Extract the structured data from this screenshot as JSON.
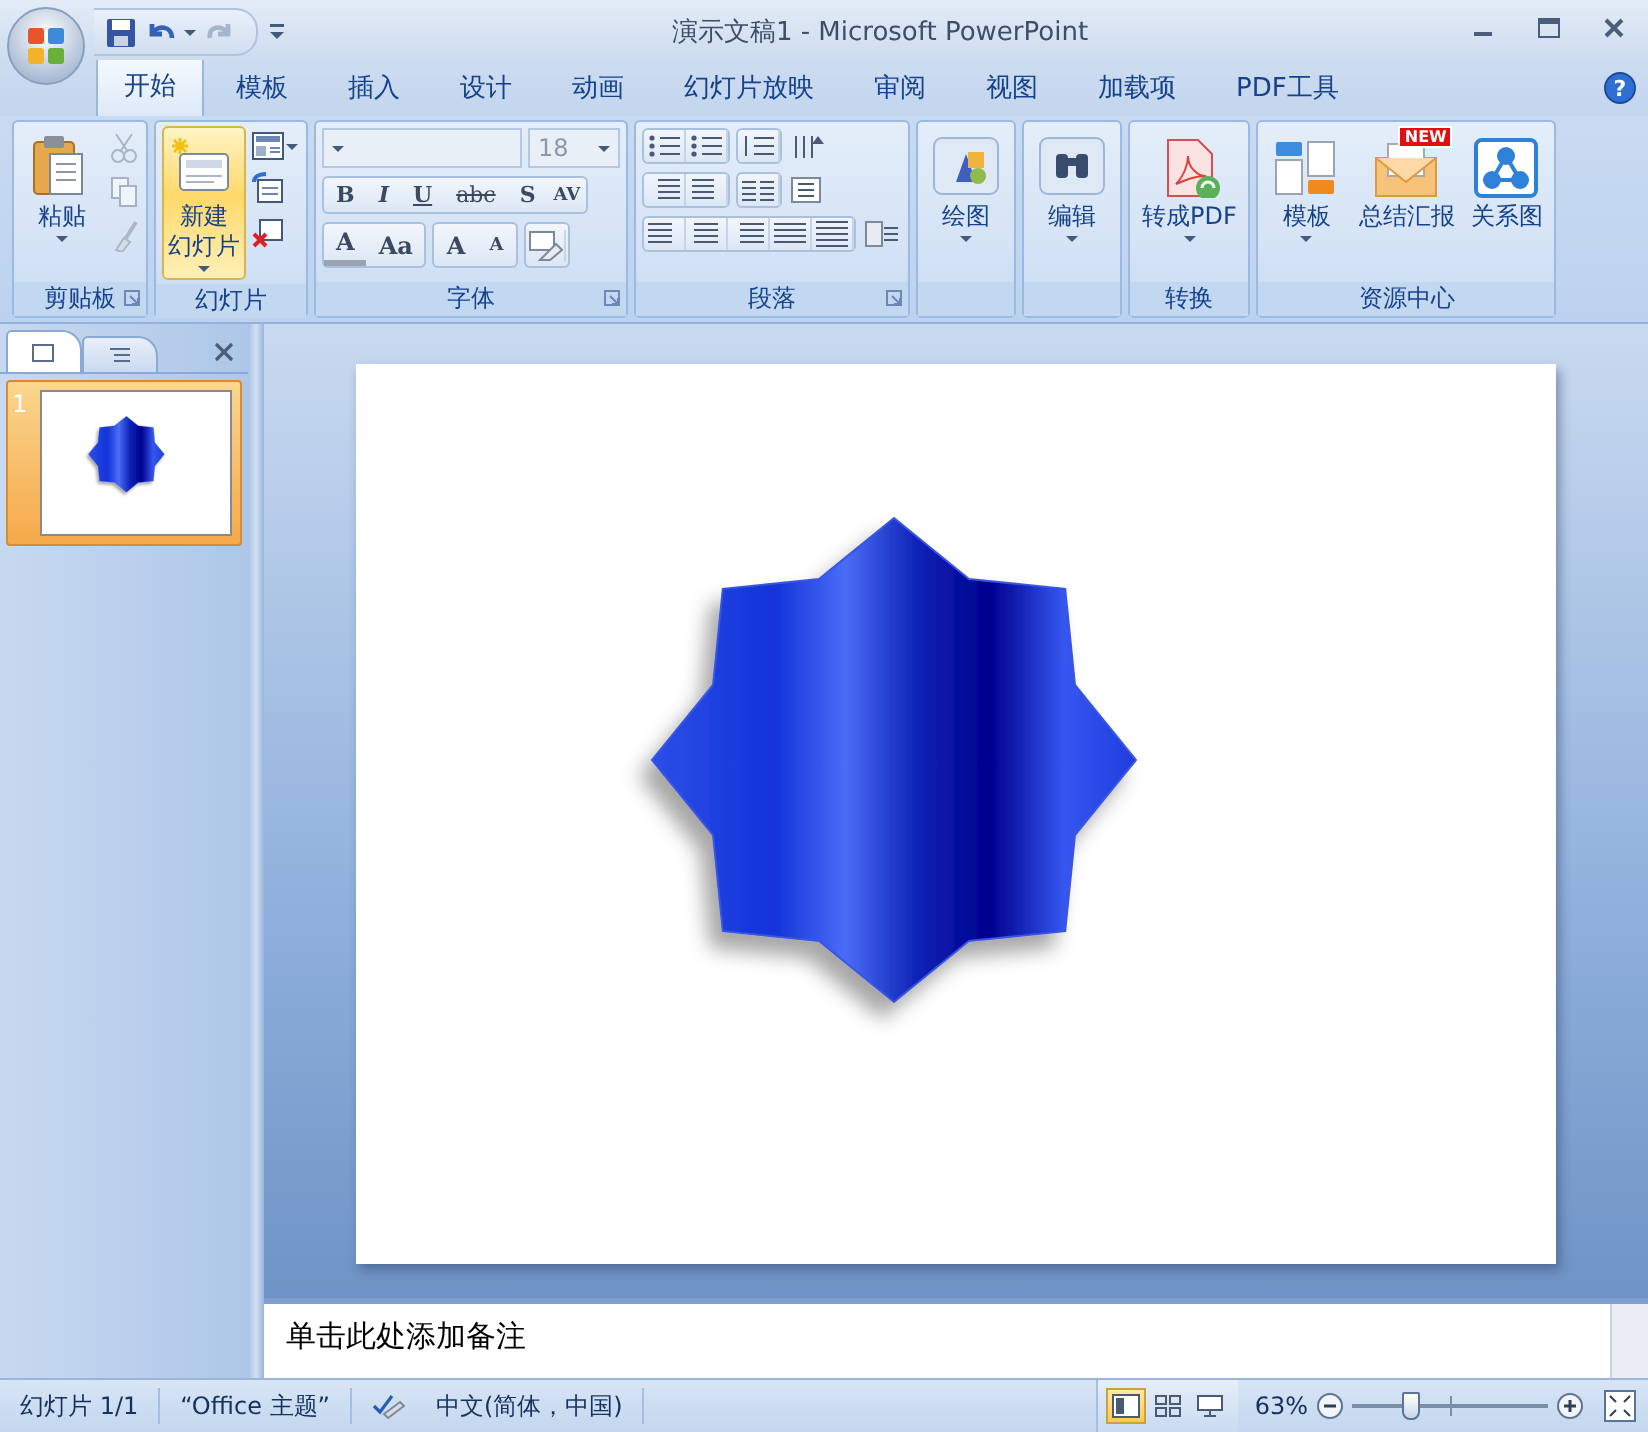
{
  "window": {
    "title": "演示文稿1 - Microsoft PowerPoint"
  },
  "tabs": [
    {
      "label": "开始",
      "selected": true
    },
    {
      "label": "模板",
      "selected": false
    },
    {
      "label": "插入",
      "selected": false
    },
    {
      "label": "设计",
      "selected": false
    },
    {
      "label": "动画",
      "selected": false
    },
    {
      "label": "幻灯片放映",
      "selected": false
    },
    {
      "label": "审阅",
      "selected": false
    },
    {
      "label": "视图",
      "selected": false
    },
    {
      "label": "加载项",
      "selected": false
    },
    {
      "label": "PDF工具",
      "selected": false
    }
  ],
  "help_button": "?",
  "ribbon": {
    "groups": [
      {
        "kind": "clipboard",
        "label": "剪贴板",
        "launcher": true,
        "big_buttons": [
          {
            "lines": [
              "粘贴"
            ],
            "dropdown": true,
            "highlighted": false
          }
        ]
      },
      {
        "kind": "slides",
        "label": "幻灯片",
        "launcher": false,
        "big_buttons": [
          {
            "lines": [
              "新建",
              "幻灯片"
            ],
            "dropdown": true,
            "highlighted": true
          }
        ]
      },
      {
        "kind": "font",
        "label": "字体",
        "launcher": true,
        "font_size": "18",
        "style_buttons": [
          "B",
          "I",
          "U",
          "abc",
          "S",
          "AV"
        ],
        "size_buttons": [
          "A",
          "Aa",
          "A",
          "A"
        ]
      },
      {
        "kind": "paragraph",
        "label": "段落",
        "launcher": true
      },
      {
        "kind": "single",
        "launcher": false,
        "big_buttons": [
          {
            "lines": [
              "绘图"
            ],
            "dropdown": true,
            "highlighted": false
          }
        ]
      },
      {
        "kind": "single",
        "launcher": false,
        "big_buttons": [
          {
            "lines": [
              "编辑"
            ],
            "dropdown": true,
            "highlighted": false
          }
        ]
      },
      {
        "kind": "single",
        "label": "转换",
        "launcher": false,
        "big_buttons": [
          {
            "lines": [
              "转成PDF"
            ],
            "dropdown": true,
            "highlighted": false
          }
        ]
      },
      {
        "kind": "single",
        "label": "资源中心",
        "launcher": false,
        "big_buttons": [
          {
            "lines": [
              "模板"
            ],
            "dropdown": true,
            "highlighted": false
          },
          {
            "lines": [
              "总结汇报"
            ],
            "badge": "NEW",
            "dropdown": false,
            "highlighted": false
          },
          {
            "lines": [
              "关系图"
            ],
            "dropdown": false,
            "highlighted": false
          }
        ]
      }
    ]
  },
  "slide_pane": {
    "tabs": [
      {
        "selected": true
      },
      {
        "selected": false
      }
    ],
    "thumbnails": [
      {
        "number": "1",
        "selected": true
      }
    ]
  },
  "notes": {
    "placeholder": "单击此处添加备注"
  },
  "status_bar": {
    "slide_counter": "幻灯片 1/1",
    "theme": "“Office 主题”",
    "language": "中文(简体，中国)",
    "views": [
      {
        "selected": true
      },
      {
        "selected": false
      },
      {
        "selected": false
      }
    ],
    "zoom": {
      "reading": "63%",
      "level": 0.3
    }
  }
}
